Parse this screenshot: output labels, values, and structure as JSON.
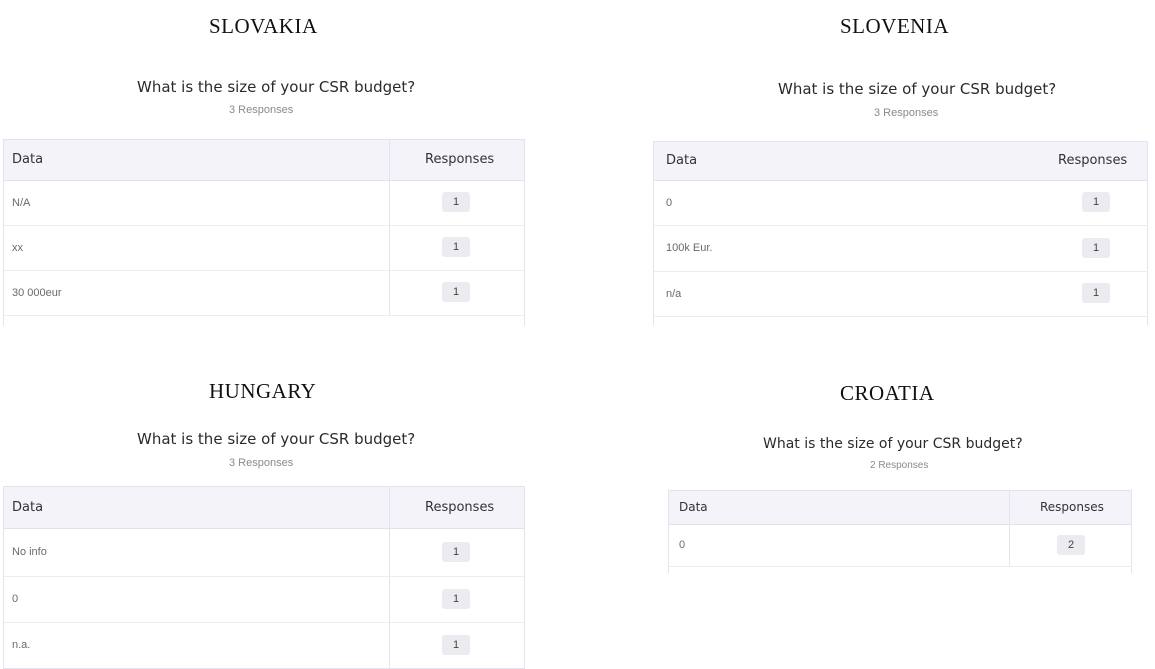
{
  "panels": [
    {
      "country": "SLOVAKIA",
      "question": "What is the size of your CSR budget?",
      "responses_count": "3 Responses",
      "columns": {
        "data": "Data",
        "responses": "Responses"
      },
      "rows": [
        {
          "data": "N/A",
          "responses": "1"
        },
        {
          "data": "xx",
          "responses": "1"
        },
        {
          "data": "30 000eur",
          "responses": "1"
        }
      ]
    },
    {
      "country": "SLOVENIA",
      "question": "What is the size of your CSR budget?",
      "responses_count": "3 Responses",
      "columns": {
        "data": "Data",
        "responses": "Responses"
      },
      "rows": [
        {
          "data": "0",
          "responses": "1"
        },
        {
          "data": "100k Eur.",
          "responses": "1"
        },
        {
          "data": "n/a",
          "responses": "1"
        }
      ]
    },
    {
      "country": "HUNGARY",
      "question": "What is the size of your CSR budget?",
      "responses_count": "3 Responses",
      "columns": {
        "data": "Data",
        "responses": "Responses"
      },
      "rows": [
        {
          "data": "No info",
          "responses": "1"
        },
        {
          "data": "0",
          "responses": "1"
        },
        {
          "data": "n.a.",
          "responses": "1"
        }
      ]
    },
    {
      "country": "CROATIA",
      "question": "What is the size of your CSR budget?",
      "responses_count": "2 Responses",
      "columns": {
        "data": "Data",
        "responses": "Responses"
      },
      "rows": [
        {
          "data": "0",
          "responses": "2"
        }
      ]
    }
  ]
}
